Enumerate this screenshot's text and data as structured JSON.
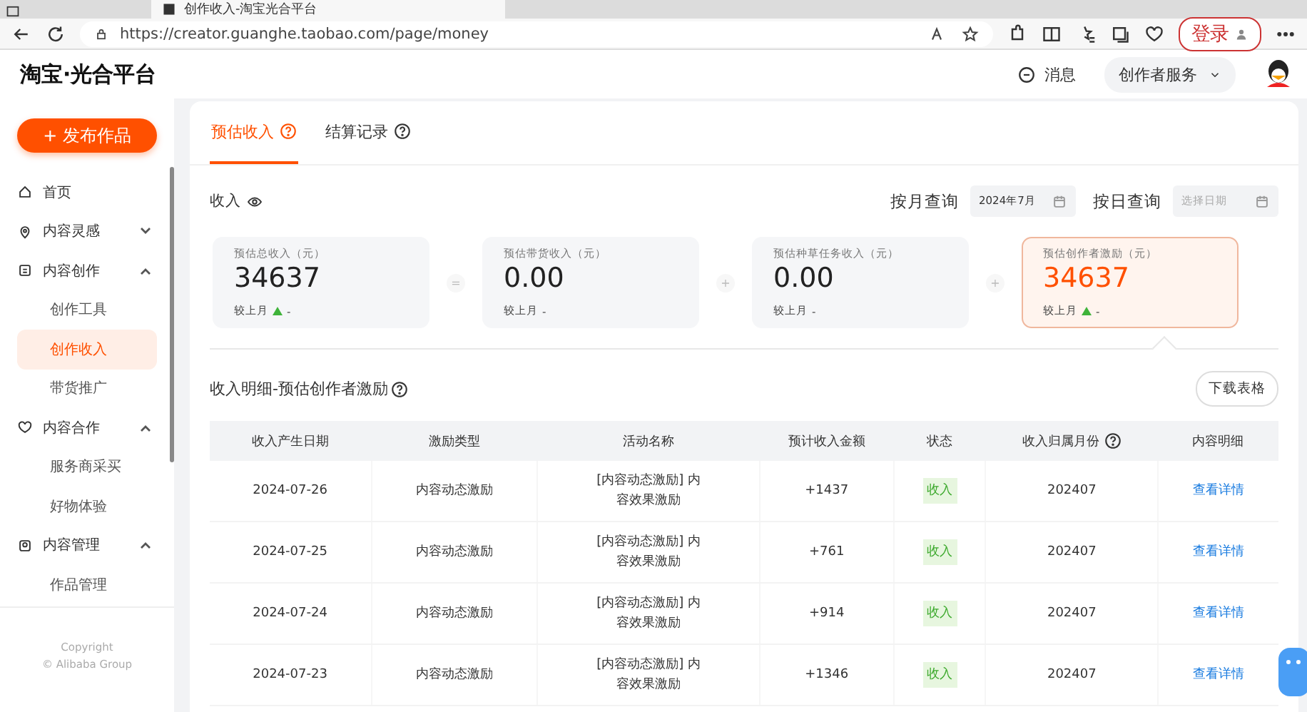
{
  "browser": {
    "tab_title": "创作收入-淘宝光合平台",
    "url": "https://creator.guanghe.taobao.com/page/money",
    "login_button": "登录"
  },
  "header": {
    "logo": "淘宝·光合平台",
    "messages": "消息",
    "services": "创作者服务"
  },
  "sidebar": {
    "publish_button": "+ 发布作品",
    "items": [
      {
        "label": "首页",
        "kind": "link",
        "selected": false
      },
      {
        "label": "内容灵感",
        "kind": "group",
        "selected": false,
        "expanded": false
      },
      {
        "label": "内容创作",
        "kind": "group",
        "selected": false,
        "expanded": true,
        "children": [
          {
            "label": "创作工具",
            "selected": false
          },
          {
            "label": "创作收入",
            "selected": true
          },
          {
            "label": "带货推广",
            "selected": false
          }
        ]
      },
      {
        "label": "内容合作",
        "kind": "group",
        "selected": false,
        "expanded": true,
        "children": [
          {
            "label": "服务商采买",
            "selected": false
          },
          {
            "label": "好物体验",
            "selected": false
          }
        ]
      },
      {
        "label": "内容管理",
        "kind": "group",
        "selected": false,
        "expanded": true,
        "children": [
          {
            "label": "作品管理",
            "selected": false
          }
        ]
      }
    ],
    "footer": [
      "Copyright",
      "© Alibaba Group"
    ]
  },
  "main": {
    "tabs": [
      {
        "label": "预估收入",
        "selected": true
      },
      {
        "label": "结算记录",
        "selected": false
      }
    ],
    "income_label": "收入",
    "month_query": {
      "label": "按月查询",
      "value": "2024年7月"
    },
    "day_query": {
      "label": "按日查询",
      "placeholder": "选择日期"
    },
    "cards": [
      {
        "title": "预估总收入（元）",
        "value": "34637",
        "compare": "较上月",
        "change": "-",
        "trend_up": true,
        "selected": false
      },
      {
        "operator": "=",
        "title": "预估带货收入（元）",
        "value": "0.00",
        "compare": "较上月",
        "change": "-",
        "trend_up": false,
        "selected": false
      },
      {
        "operator": "+",
        "title": "预估种草任务收入（元）",
        "value": "0.00",
        "compare": "较上月",
        "change": "-",
        "trend_up": false,
        "selected": false
      },
      {
        "operator": "+",
        "title": "预估创作者激励（元）",
        "value": "34637",
        "compare": "较上月",
        "change": "-",
        "trend_up": true,
        "selected": true
      }
    ],
    "section_title": "收入明细-预估创作者激励",
    "download_button": "下载表格",
    "table": {
      "columns": [
        {
          "label": "收入产生日期",
          "help": false
        },
        {
          "label": "激励类型",
          "help": false
        },
        {
          "label": "活动名称",
          "help": false
        },
        {
          "label": "预计收入金额",
          "help": false
        },
        {
          "label": "状态",
          "help": false
        },
        {
          "label": "收入归属月份",
          "help": true
        },
        {
          "label": "内容明细",
          "help": false
        }
      ],
      "rows": [
        {
          "date": "2024-07-26",
          "type": "内容动态激励",
          "activity": "[内容动态激励] 内容效果激励",
          "amount": "+1437",
          "status": "收入",
          "month": "202407",
          "detail": "查看详情"
        },
        {
          "date": "2024-07-25",
          "type": "内容动态激励",
          "activity": "[内容动态激励] 内容效果激励",
          "amount": "+761",
          "status": "收入",
          "month": "202407",
          "detail": "查看详情"
        },
        {
          "date": "2024-07-24",
          "type": "内容动态激励",
          "activity": "[内容动态激励] 内容效果激励",
          "amount": "+914",
          "status": "收入",
          "month": "202407",
          "detail": "查看详情"
        },
        {
          "date": "2024-07-23",
          "type": "内容动态激励",
          "activity": "[内容动态激励] 内容效果激励",
          "amount": "+1346",
          "status": "收入",
          "month": "202407",
          "detail": "查看详情"
        }
      ]
    }
  }
}
